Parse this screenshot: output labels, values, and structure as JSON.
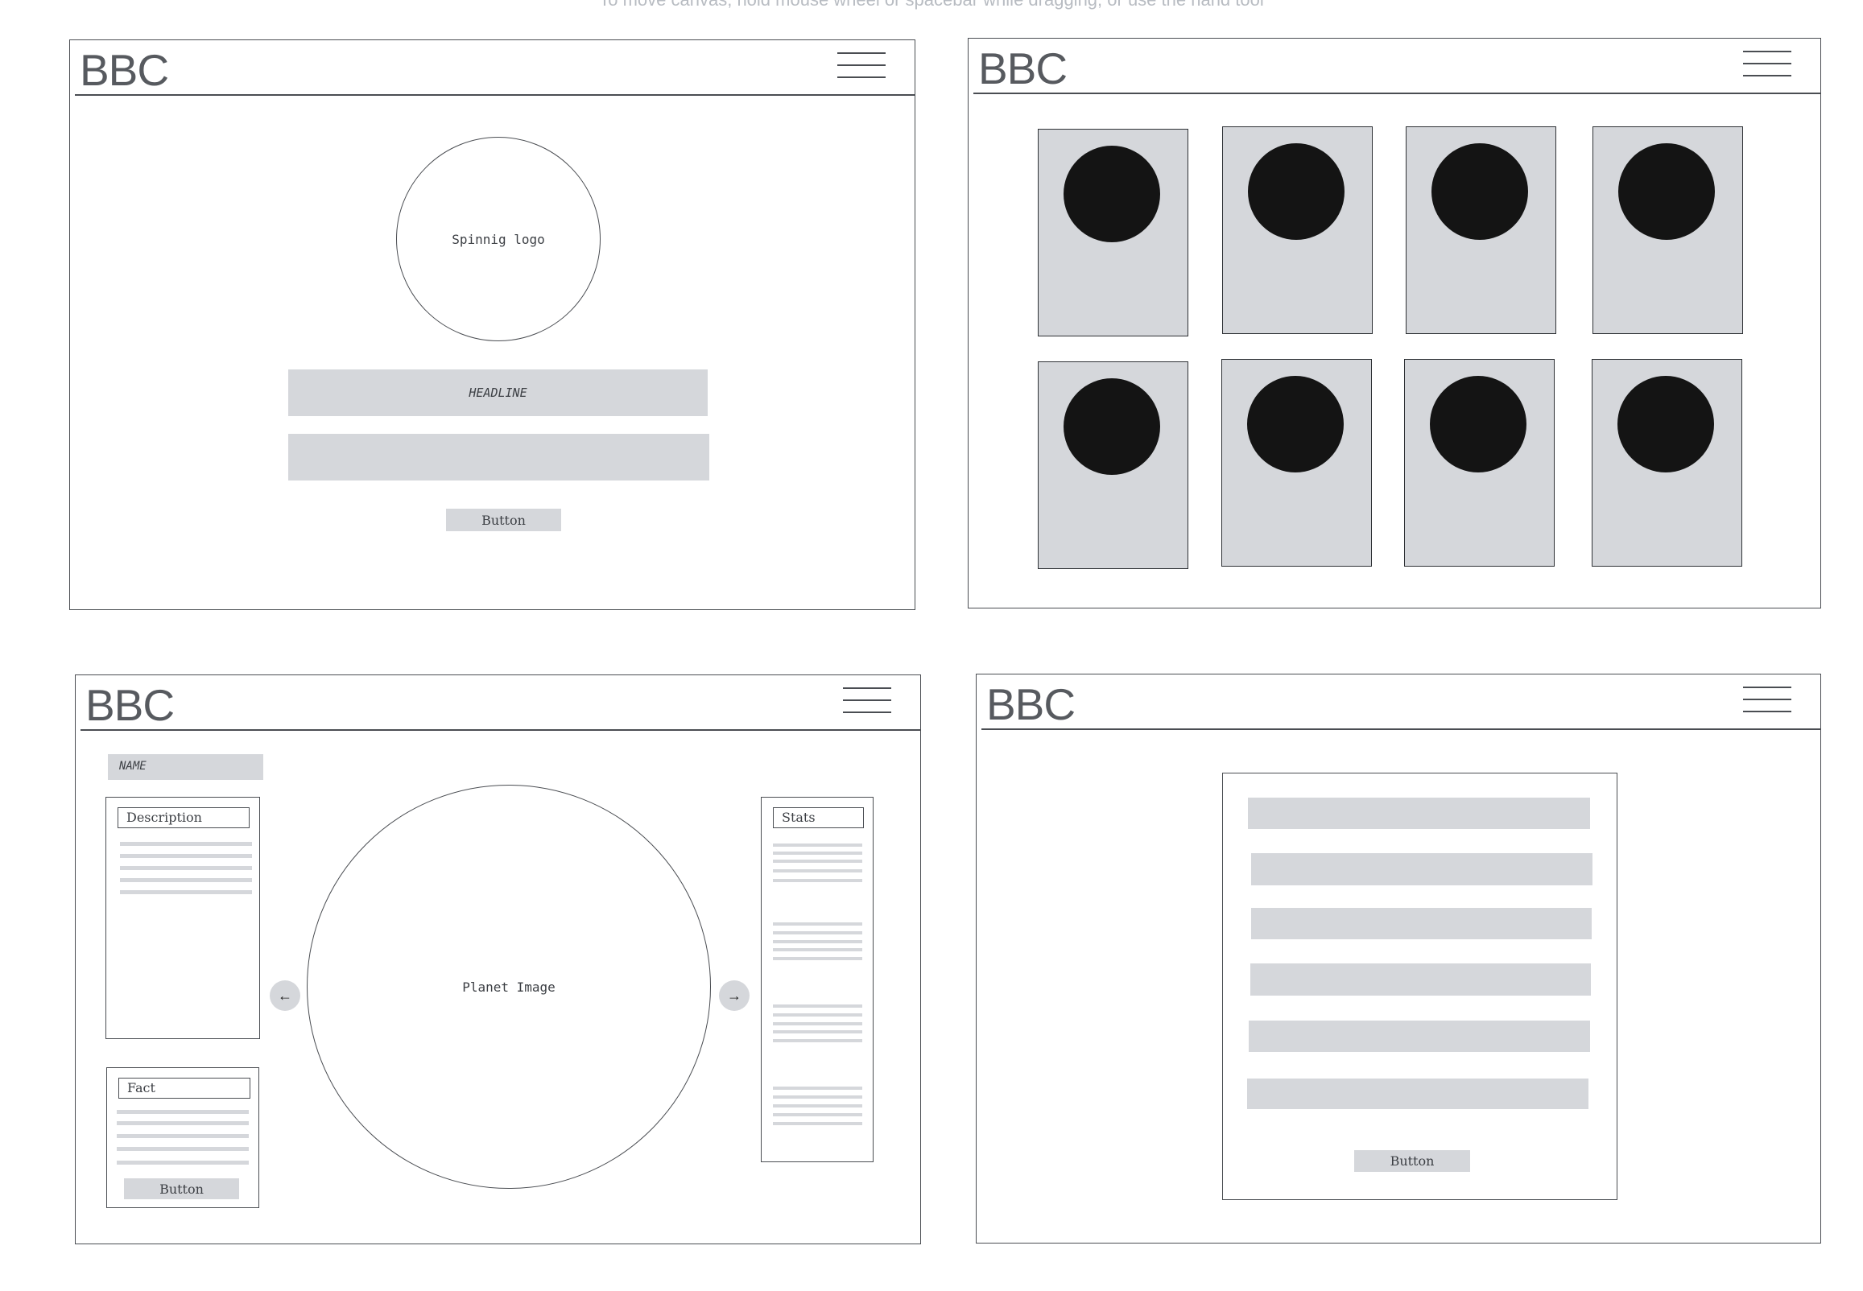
{
  "canvas_hint": "To move canvas, hold mouse wheel or spacebar while dragging, or use the hand tool",
  "logo_text": "BBC",
  "frame1": {
    "logo_caption": "Spinnig logo",
    "headline": "HEADLINE",
    "button_label": "Button"
  },
  "frame2": {
    "card_count": 8
  },
  "frame3": {
    "name_label": "NAME",
    "description_title": "Description",
    "fact_title": "Fact",
    "fact_button_label": "Button",
    "planet_caption": "Planet Image",
    "stats_title": "Stats",
    "prev_arrow": "←",
    "next_arrow": "→"
  },
  "frame4": {
    "button_label": "Button"
  },
  "colors": {
    "placeholder_gray": "#d5d7db",
    "stroke": "#4a4d52",
    "dot": "#141414",
    "logo": "#575a5f"
  },
  "icons": [
    "hamburger-menu-icon",
    "arrow-left-icon",
    "arrow-right-icon"
  ]
}
